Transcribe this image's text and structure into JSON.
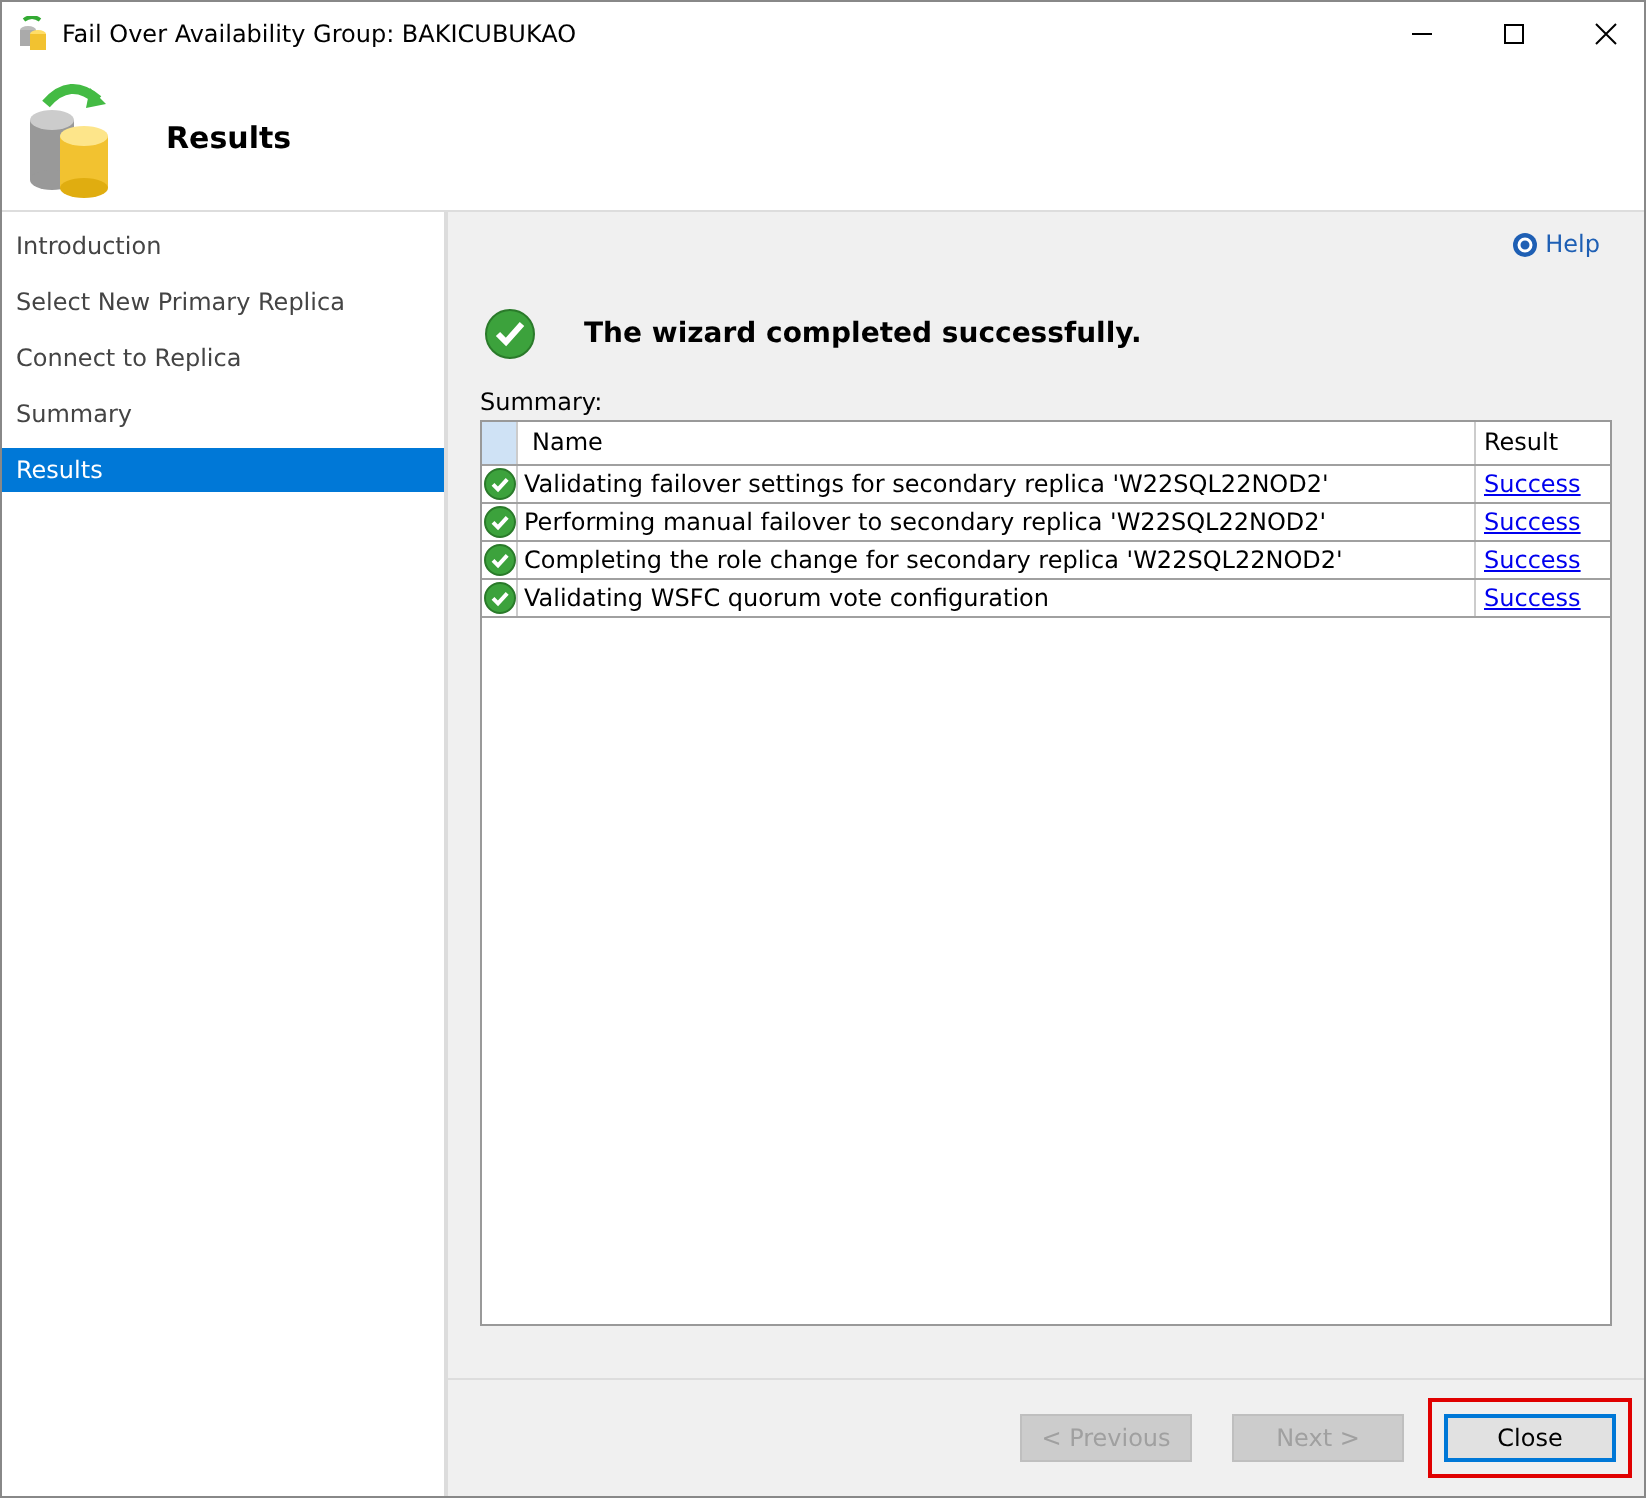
{
  "window": {
    "title": "Fail Over Availability Group: BAKICUBUKAO"
  },
  "header": {
    "title": "Results"
  },
  "sidebar": {
    "items": [
      {
        "label": "Introduction",
        "selected": false
      },
      {
        "label": "Select New Primary Replica",
        "selected": false
      },
      {
        "label": "Connect to Replica",
        "selected": false
      },
      {
        "label": "Summary",
        "selected": false
      },
      {
        "label": "Results",
        "selected": true
      }
    ]
  },
  "help_link": "Help",
  "status_message": "The wizard completed successfully.",
  "summary_label": "Summary:",
  "table": {
    "columns": [
      "Name",
      "Result"
    ],
    "rows": [
      {
        "name": "Validating failover settings for secondary replica 'W22SQL22NOD2'",
        "result": "Success"
      },
      {
        "name": "Performing manual failover to secondary replica 'W22SQL22NOD2'",
        "result": "Success"
      },
      {
        "name": "Completing the role change for secondary replica 'W22SQL22NOD2'",
        "result": "Success"
      },
      {
        "name": "Validating WSFC quorum vote configuration",
        "result": "Success"
      }
    ]
  },
  "buttons": [
    {
      "label": "< Previous",
      "disabled": true,
      "highlighted": false
    },
    {
      "label": "Next >",
      "disabled": true,
      "highlighted": false
    },
    {
      "label": "Close",
      "disabled": false,
      "highlighted": true
    }
  ]
}
